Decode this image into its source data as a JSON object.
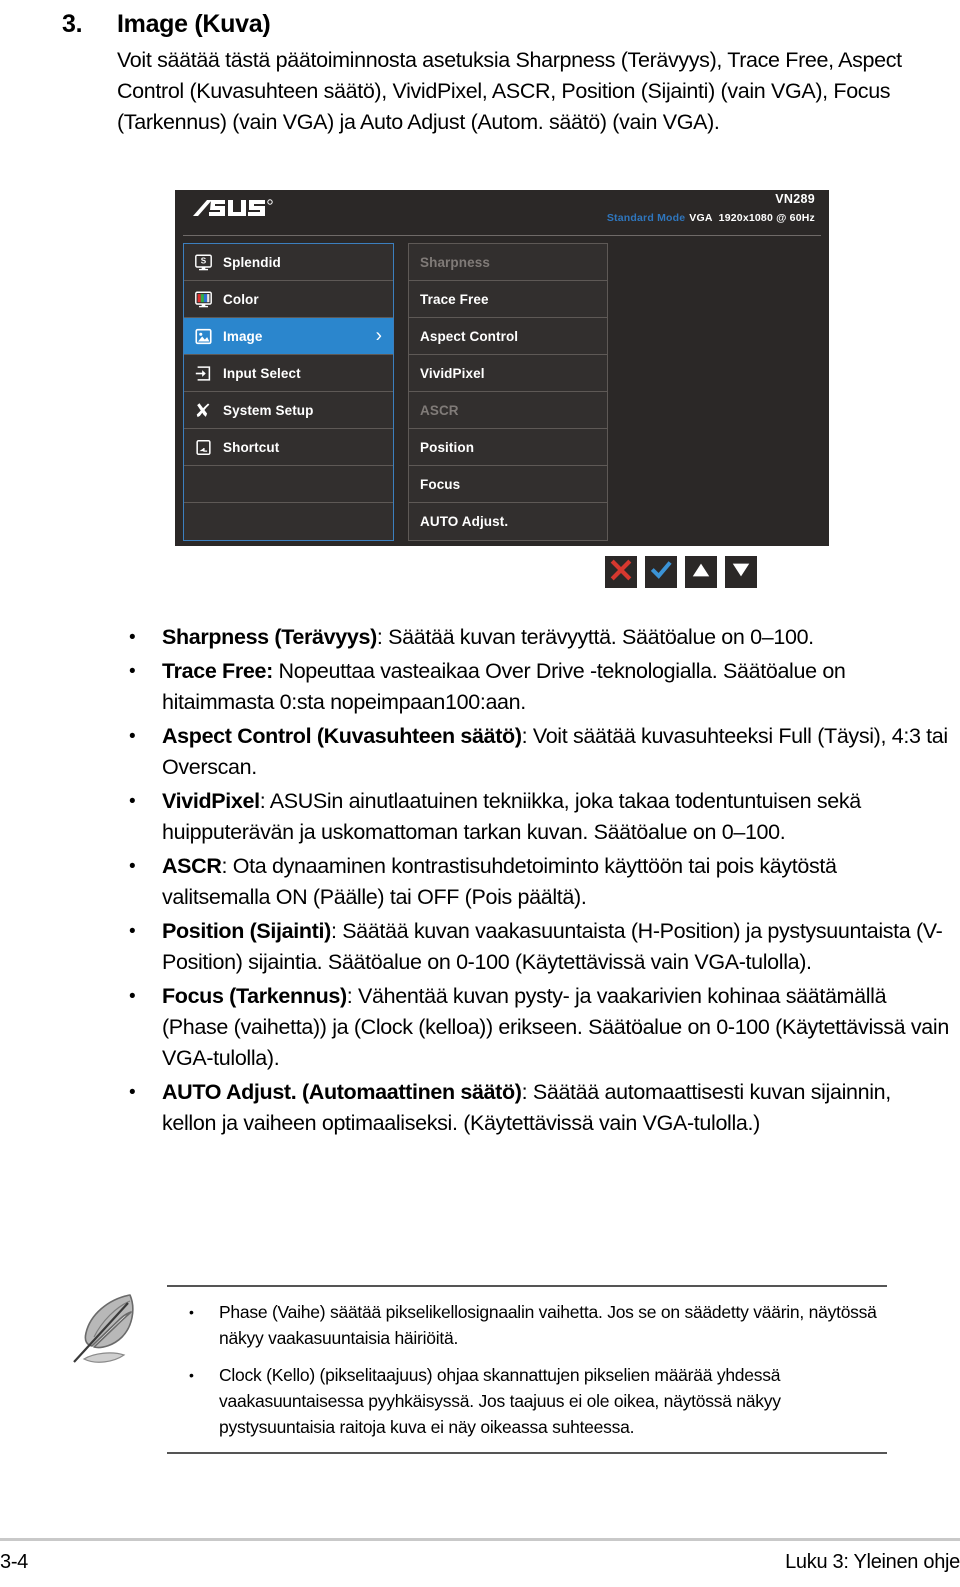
{
  "section": {
    "number": "3.",
    "title": "Image (Kuva)",
    "intro": "Voit säätää tästä päätoiminnosta asetuksia Sharpness (Terävyys), Trace Free, Aspect Control (Kuvasuhteen säätö), VividPixel, ASCR, Position (Sijainti) (vain VGA), Focus (Tarkennus) (vain VGA) ja Auto Adjust (Autom. säätö) (vain VGA)."
  },
  "osd": {
    "brand": "ASUS",
    "model": "VN289",
    "status": {
      "mode": "Standard Mode",
      "source": "VGA",
      "resolution": "1920x1080 @ 60Hz"
    },
    "main_menu": [
      {
        "label": "Splendid",
        "icon": "splendid-icon",
        "selected": false,
        "chevron": false
      },
      {
        "label": "Color",
        "icon": "color-icon",
        "selected": false,
        "chevron": false
      },
      {
        "label": "Image",
        "icon": "image-icon",
        "selected": true,
        "chevron": true
      },
      {
        "label": "Input Select",
        "icon": "input-select-icon",
        "selected": false,
        "chevron": false
      },
      {
        "label": "System Setup",
        "icon": "system-setup-icon",
        "selected": false,
        "chevron": false
      },
      {
        "label": "Shortcut",
        "icon": "shortcut-icon",
        "selected": false,
        "chevron": false
      },
      {
        "label": "",
        "icon": "",
        "selected": false,
        "chevron": false
      },
      {
        "label": "",
        "icon": "",
        "selected": false,
        "chevron": false
      }
    ],
    "sub_menu": [
      {
        "label": "Sharpness",
        "disabled": true
      },
      {
        "label": "Trace Free",
        "disabled": false
      },
      {
        "label": "Aspect Control",
        "disabled": false
      },
      {
        "label": "VividPixel",
        "disabled": false
      },
      {
        "label": "ASCR",
        "disabled": true
      },
      {
        "label": "Position",
        "disabled": false
      },
      {
        "label": "Focus",
        "disabled": false
      },
      {
        "label": "AUTO Adjust.",
        "disabled": false
      }
    ],
    "nav_buttons": [
      {
        "name": "close-button",
        "icon": "close-x-icon",
        "color": "#d6382f"
      },
      {
        "name": "confirm-button",
        "icon": "check-icon",
        "color": "#3b93d6"
      },
      {
        "name": "up-button",
        "icon": "triangle-up-icon",
        "color": "#ffffff"
      },
      {
        "name": "down-button",
        "icon": "triangle-down-icon",
        "color": "#ffffff"
      }
    ]
  },
  "bullets": [
    {
      "term": "Sharpness (Terävyys)",
      "sep": ": ",
      "rest": "Säätää kuvan terävyyttä. Säätöalue on 0–100."
    },
    {
      "term": "Trace Free:",
      "sep": " ",
      "rest": "Nopeuttaa vasteaikaa Over Drive -teknologialla. Säätöalue on hitaimmasta 0:sta nopeimpaan100:aan."
    },
    {
      "term": "Aspect Control (Kuvasuhteen säätö)",
      "sep": ": ",
      "rest": "Voit säätää kuvasuhteeksi Full (Täysi), 4:3 tai Overscan."
    },
    {
      "term": "VividPixel",
      "sep": ": ",
      "rest": "ASUSin ainutlaatuinen tekniikka, joka takaa todentuntuisen sekä huipputerävän ja uskomattoman tarkan kuvan. Säätöalue on 0–100."
    },
    {
      "term": "ASCR",
      "sep": ": ",
      "rest": "Ota dynaaminen kontrastisuhdetoiminto käyttöön tai pois käytöstä valitsemalla ON (Päälle) tai OFF (Pois päältä)."
    },
    {
      "term": "Position (Sijainti)",
      "sep": ": ",
      "rest": "Säätää kuvan vaakasuuntaista (H-Position) ja pystysuuntaista (V-Position) sijaintia. Säätöalue on 0-100 (Käytettävissä vain VGA-tulolla)."
    },
    {
      "term": "Focus (Tarkennus)",
      "sep": ": ",
      "rest": "Vähentää kuvan pysty- ja vaakarivien kohinaa säätämällä (Phase (vaihetta)) ja (Clock (kelloa)) erikseen. Säätöalue on 0-100 (Käytettävissä vain VGA-tulolla)."
    },
    {
      "term": "AUTO Adjust. (Automaattinen säätö)",
      "sep": ": ",
      "rest": "Säätää automaattisesti kuvan sijainnin, kellon ja vaiheen optimaaliseksi. (Käytettävissä vain VGA-tulolla.)"
    }
  ],
  "note": {
    "icon": "feather-note-icon",
    "items": [
      "Phase (Vaihe) säätää pikselikellosignaalin vaihetta. Jos se on säädetty väärin, näytössä näkyy vaakasuuntaisia häiriöitä.",
      "Clock (Kello) (pikselitaajuus) ohjaa skannattujen pikselien määrää yhdessä vaakasuuntaisessa pyyhkäisyssä. Jos taajuus ei ole oikea, näytössä näkyy pystysuuntaisia raitoja kuva ei näy oikeassa suhteessa."
    ]
  },
  "footer": {
    "page": "3-4",
    "chapter": "Luku 3: Yleinen ohje"
  },
  "colors": {
    "osd_bg": "#2b2827",
    "osd_row": "#322f2e",
    "osd_selected": "#2b86cd",
    "osd_border_blue": "#3c7fbe",
    "osd_border_gray": "#5e5956",
    "status_mode_blue": "#2f76bd",
    "disabled_text": "#807b78",
    "nav_close_red": "#d6382f",
    "nav_check_blue": "#3b93d6"
  }
}
